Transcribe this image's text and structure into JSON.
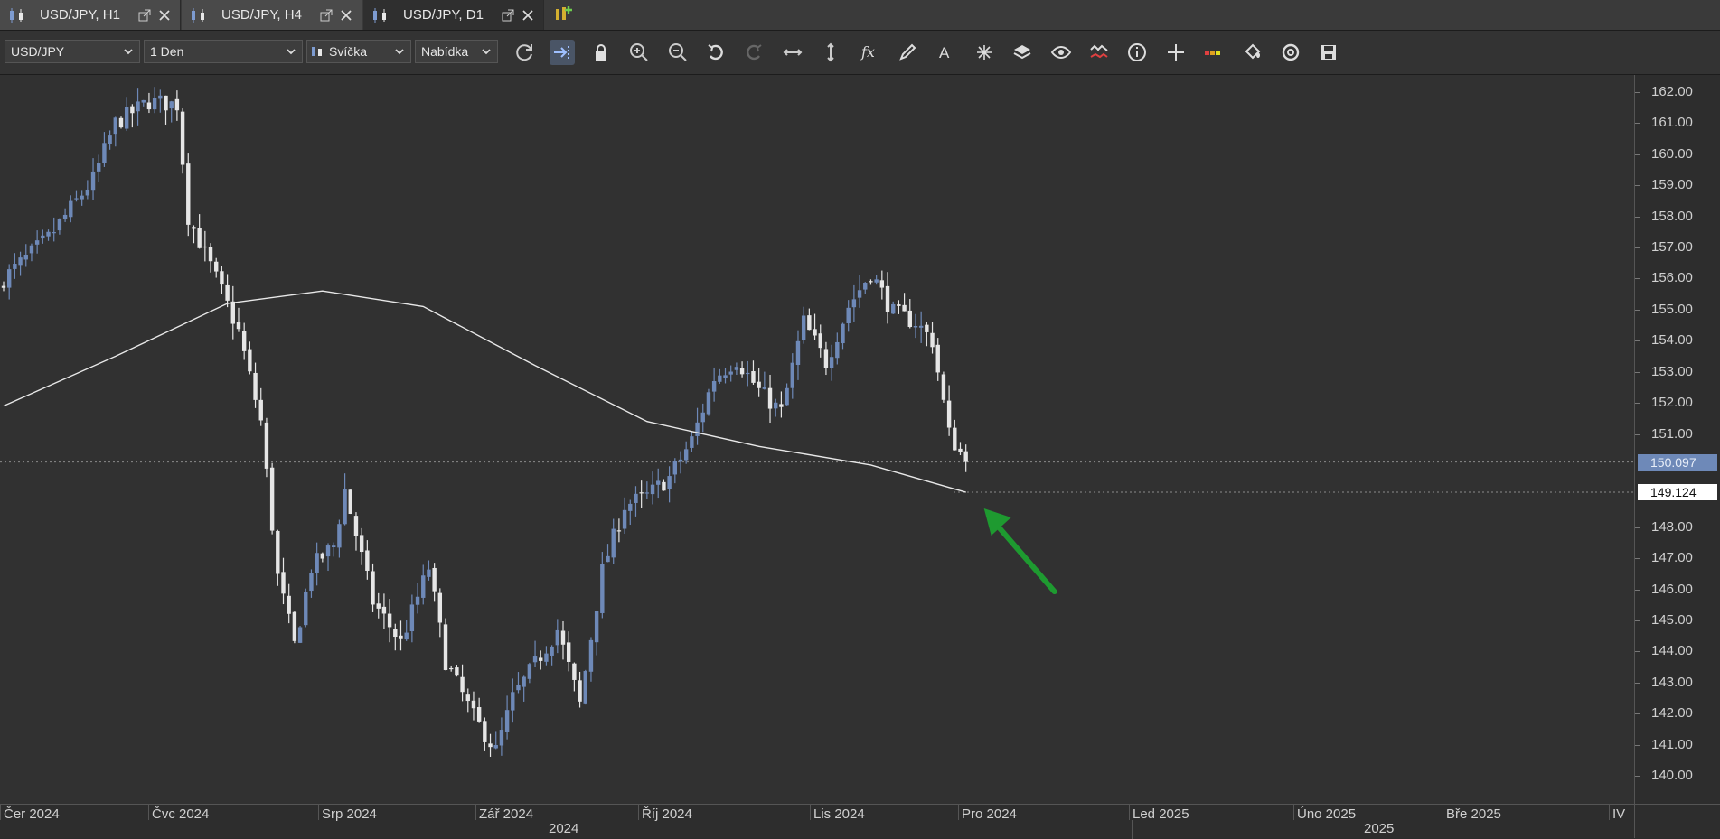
{
  "tabs": [
    {
      "label": "USD/JPY, H1",
      "active": false
    },
    {
      "label": "USD/JPY, H4",
      "active": false
    },
    {
      "label": "USD/JPY, D1",
      "active": true
    }
  ],
  "toolbar": {
    "instrument": "USD/JPY",
    "period": "1 Den",
    "chart_type": "Svíčka",
    "price_side": "Nabídka",
    "icons": [
      "refresh-icon",
      "auto-shift-icon",
      "lock-icon",
      "zoom-in-icon",
      "zoom-out-icon",
      "undo-icon",
      "redo-icon",
      "fit-horizontal-icon",
      "fit-vertical-icon",
      "indicators-fx-icon",
      "pencil-icon",
      "text-icon",
      "pattern-icon",
      "layers-icon",
      "eye-icon",
      "compare-icon",
      "info-icon",
      "crosshair-icon",
      "color-palette-icon",
      "paint-bucket-icon",
      "target-icon",
      "save-icon"
    ]
  },
  "price_labels": {
    "last_price": "150.097",
    "ma_value": "149.124"
  },
  "colors": {
    "bull": "#6e89b8",
    "bear": "#e6e6e6",
    "ma": "#e8e8e8",
    "arrow": "#1e9a30",
    "last_price_bg": "#6e89b8"
  },
  "chart_data": {
    "type": "candlestick",
    "instrument": "USD/JPY",
    "timeframe": "D1",
    "ylim": [
      139.5,
      162.3
    ],
    "y_ticks": [
      "162.00",
      "161.00",
      "160.00",
      "159.00",
      "158.00",
      "157.00",
      "156.00",
      "155.00",
      "154.00",
      "153.00",
      "152.00",
      "151.00",
      "150.00",
      "149.00",
      "148.00",
      "147.00",
      "146.00",
      "145.00",
      "144.00",
      "143.00",
      "142.00",
      "141.00",
      "140.00"
    ],
    "x_labels": [
      "Čer 2024",
      "Čvc 2024",
      "Srp 2024",
      "Zář 2024",
      "Říj 2024",
      "Lis 2024",
      "Pro 2024",
      "Led 2025",
      "Úno 2025",
      "Bře 2025",
      "IV"
    ],
    "years": [
      "2024",
      "2025"
    ],
    "anchors": [
      {
        "day": 0,
        "close": 156.0
      },
      {
        "day": 8,
        "close": 157.3
      },
      {
        "day": 16,
        "close": 159.2
      },
      {
        "day": 20,
        "close": 161.0
      },
      {
        "day": 26,
        "close": 161.7
      },
      {
        "day": 31,
        "close": 161.6
      },
      {
        "day": 33,
        "close": 158.0
      },
      {
        "day": 38,
        "close": 156.0
      },
      {
        "day": 42,
        "close": 154.3
      },
      {
        "day": 46,
        "close": 151.4
      },
      {
        "day": 49,
        "close": 146.4
      },
      {
        "day": 52,
        "close": 144.2
      },
      {
        "day": 55,
        "close": 146.7
      },
      {
        "day": 59,
        "close": 147.4
      },
      {
        "day": 61,
        "close": 149.2
      },
      {
        "day": 66,
        "close": 145.6
      },
      {
        "day": 71,
        "close": 144.3
      },
      {
        "day": 76,
        "close": 146.7
      },
      {
        "day": 79,
        "close": 143.7
      },
      {
        "day": 84,
        "close": 141.9
      },
      {
        "day": 88,
        "close": 140.8
      },
      {
        "day": 91,
        "close": 142.5
      },
      {
        "day": 95,
        "close": 143.6
      },
      {
        "day": 99,
        "close": 144.7
      },
      {
        "day": 103,
        "close": 142.3
      },
      {
        "day": 107,
        "close": 146.6
      },
      {
        "day": 111,
        "close": 148.7
      },
      {
        "day": 115,
        "close": 149.0
      },
      {
        "day": 119,
        "close": 149.6
      },
      {
        "day": 123,
        "close": 150.8
      },
      {
        "day": 127,
        "close": 152.8
      },
      {
        "day": 131,
        "close": 153.4
      },
      {
        "day": 135,
        "close": 152.4
      },
      {
        "day": 139,
        "close": 151.7
      },
      {
        "day": 143,
        "close": 154.6
      },
      {
        "day": 147,
        "close": 153.3
      },
      {
        "day": 151,
        "close": 155.1
      },
      {
        "day": 155,
        "close": 156.2
      },
      {
        "day": 159,
        "close": 154.9
      },
      {
        "day": 163,
        "close": 154.6
      },
      {
        "day": 166,
        "close": 154.0
      },
      {
        "day": 169,
        "close": 151.0
      },
      {
        "day": 172,
        "close": 150.097
      }
    ],
    "moving_average": [
      {
        "day": 0,
        "value": 151.9
      },
      {
        "day": 20,
        "value": 153.5
      },
      {
        "day": 40,
        "value": 155.2
      },
      {
        "day": 57,
        "value": 155.6
      },
      {
        "day": 75,
        "value": 155.1
      },
      {
        "day": 95,
        "value": 153.2
      },
      {
        "day": 115,
        "value": 151.4
      },
      {
        "day": 135,
        "value": 150.6
      },
      {
        "day": 155,
        "value": 150.0
      },
      {
        "day": 172,
        "value": 149.124
      }
    ]
  }
}
